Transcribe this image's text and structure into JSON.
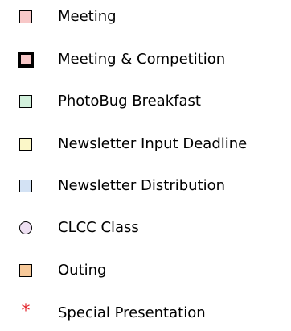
{
  "legend": {
    "items": [
      {
        "label": "Meeting",
        "marker": "square",
        "color": "#f8c8c8"
      },
      {
        "label": "Meeting & Competition",
        "marker": "square-bold",
        "color": "#f8c8c8"
      },
      {
        "label": "PhotoBug Breakfast",
        "marker": "square",
        "color": "#d2f0dc"
      },
      {
        "label": "Newsletter Input Deadline",
        "marker": "square",
        "color": "#fbf7c8"
      },
      {
        "label": "Newsletter Distribution",
        "marker": "square",
        "color": "#d3e2f4"
      },
      {
        "label": "CLCC Class",
        "marker": "circle",
        "color": "#eee0f2"
      },
      {
        "label": "Outing",
        "marker": "square",
        "color": "#f7c99a"
      },
      {
        "label": "Special Presentation",
        "marker": "asterisk",
        "color": "#e3262d",
        "symbol": "*"
      }
    ]
  }
}
